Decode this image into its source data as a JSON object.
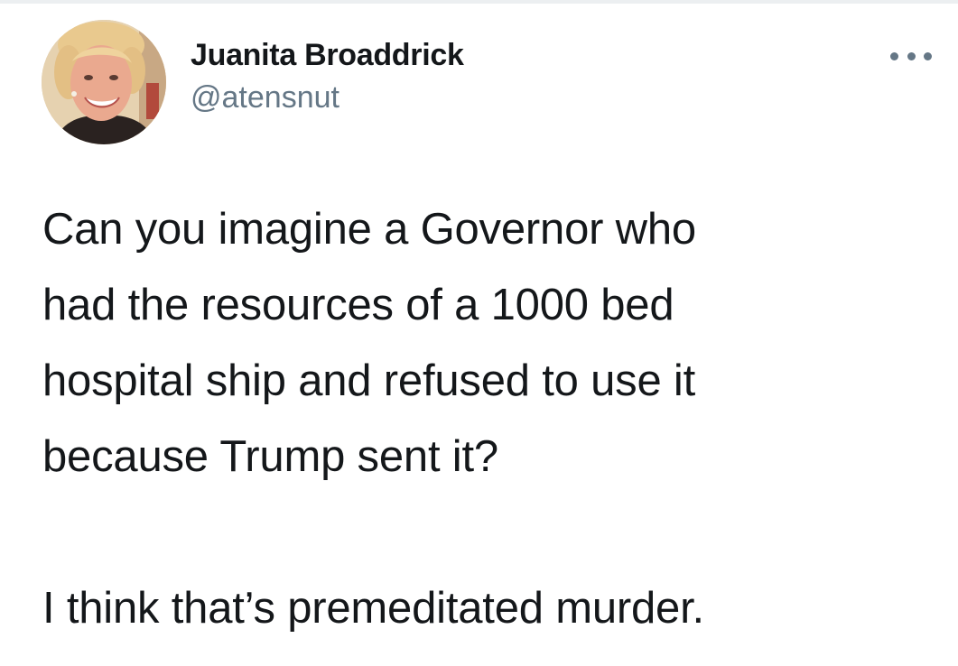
{
  "tweet": {
    "author": {
      "display_name": "Juanita Broaddrick",
      "handle": "@atensnut",
      "avatar_icon": "profile-photo"
    },
    "more_icon": "ellipsis-icon",
    "text": {
      "paragraph_1": "Can you imagine a Governor who\nhad the resources of a 1000 bed\nhospital ship and refused to use it\nbecause Trump sent it?",
      "paragraph_2": "I think that’s premeditated murder."
    }
  },
  "colors": {
    "text_primary": "#14171a",
    "text_secondary": "#657786",
    "background": "#ffffff"
  }
}
